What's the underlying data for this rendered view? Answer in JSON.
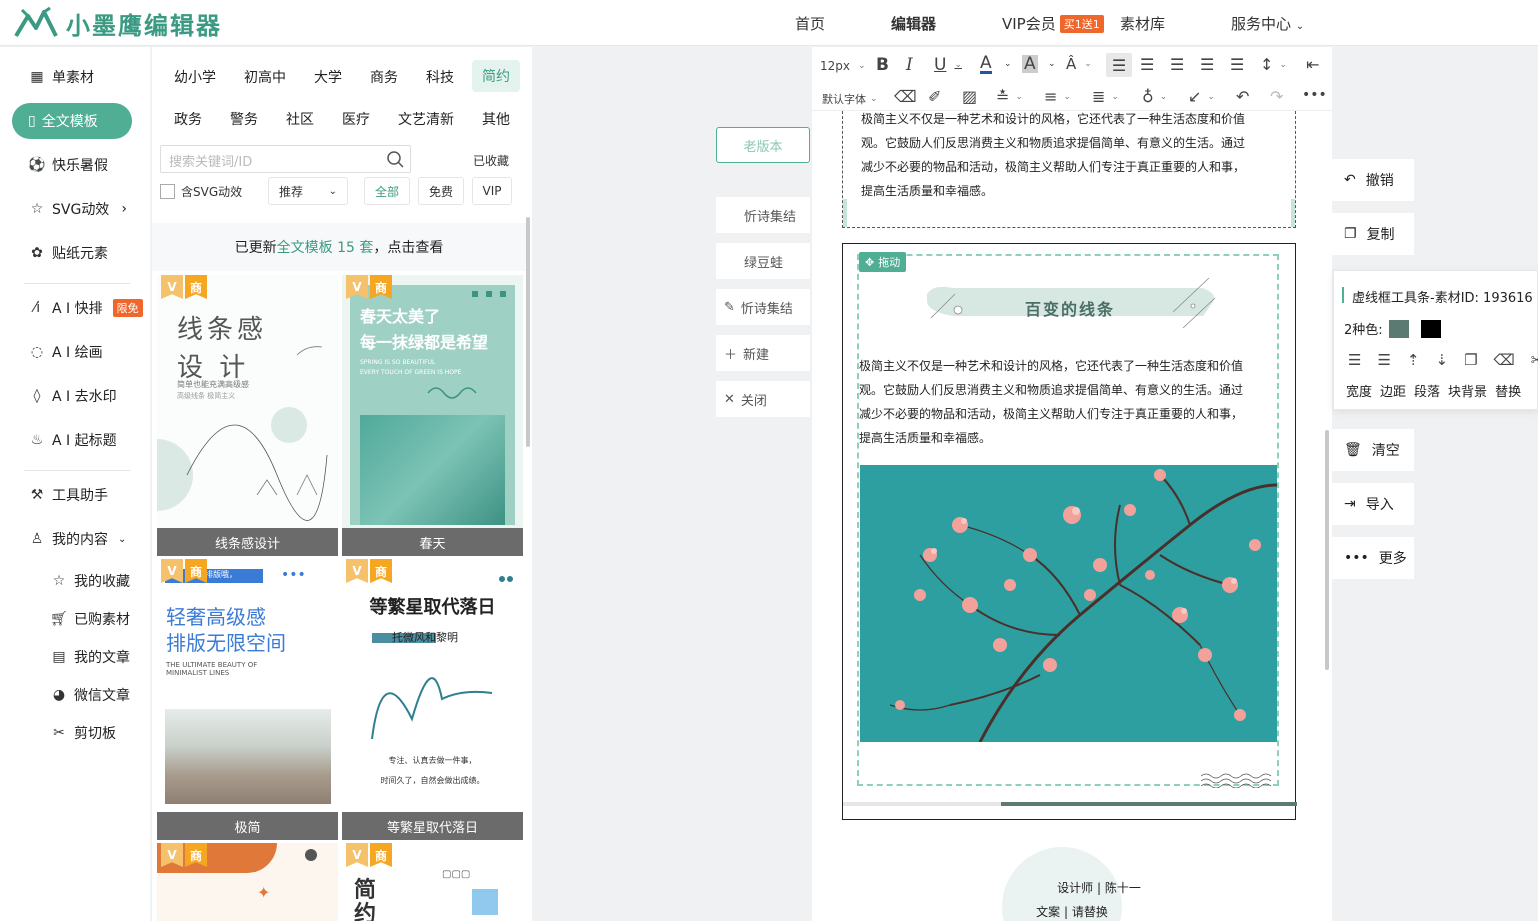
{
  "brand": {
    "name": "小墨鹰编辑器",
    "accent": "#4fae94"
  },
  "nav": {
    "home": "首页",
    "editor": "编辑器",
    "vip": "VIP会员",
    "vip_tag": "买1送1",
    "library": "素材库",
    "service": "服务中心"
  },
  "sidebar": {
    "single": "单素材",
    "full_template": "全文模板",
    "summer": "快乐暑假",
    "svg": "SVG动效",
    "stickers": "贴纸元素",
    "ai_typeset": "A I 快排",
    "ai_typeset_tag": "限免",
    "ai_draw": "A I 绘画",
    "ai_watermark": "A I 去水印",
    "ai_title": "A I 起标题",
    "tools": "工具助手",
    "my_content": "我的内容",
    "favorites": "我的收藏",
    "purchased": "已购素材",
    "articles": "我的文章",
    "wechat": "微信文章",
    "clipboard": "剪切板"
  },
  "templates": {
    "categories_row1": [
      "幼小学",
      "初高中",
      "大学",
      "商务",
      "科技",
      "简约"
    ],
    "categories_row2": [
      "政务",
      "警务",
      "社区",
      "医疗",
      "文艺清新",
      "其他"
    ],
    "search_placeholder": "搜索关键词/ID",
    "collected": "已收藏",
    "svg_check": "含SVG动效",
    "sort": "推荐",
    "filters": [
      "全部",
      "免费",
      "VIP"
    ],
    "banner_pre": "已更新",
    "banner_link": "全文模板 15 套",
    "banner_post": "，点击查看",
    "badge": "商",
    "cards": [
      {
        "label": "线条感设计",
        "title1": "线条感",
        "title2": "设  计",
        "sub1": "简单也能充满高级感",
        "sub2": "高级线条 极简主义"
      },
      {
        "label": "春天",
        "title1": "春天太美了",
        "title2": "每一抹绿都是希望",
        "sub1": "SPRING IS SO BEAUTIFUL",
        "sub2": "EVERY TOUCH OF GREEN IS HOPE"
      },
      {
        "label": "极简",
        "title1": "轻奢高级感",
        "title2": "排版无限空间",
        "sub1": "THE ULTIMATE BEAUTY OF",
        "sub2": "MINIMALIST LINES",
        "tag": "排版哦，"
      },
      {
        "label": "等繁星取代落日",
        "title1": "等繁星取代落日",
        "title2": "托微风和黎明",
        "sub1": "专注、认真去做一件事，",
        "sub2": "时间久了，自然会做出成绩。"
      },
      {
        "label": "",
        "title1": "",
        "title2": "",
        "sub1": "",
        "sub2": ""
      },
      {
        "label": "",
        "title1": "简约",
        "title2": "",
        "sub1": "",
        "sub2": ""
      }
    ]
  },
  "versions": {
    "old": "老版本",
    "items": [
      "忻诗集结",
      "绿豆蛙",
      "忻诗集结"
    ],
    "new": "新建",
    "close": "关闭"
  },
  "toolbar": {
    "font_size": "12px",
    "font_family": "默认字体"
  },
  "article": {
    "para_top_1": "极简主义不仅是一种艺术和设计的风格，它还代表了一种生活态度和价值",
    "para_top_2": "观。它鼓励人们反思消费主义和物质追求提倡简单、有意义的生活。通过",
    "para_top_3": "减少不必要的物品和活动，极简主义帮助人们专注于真正重要的人和事，",
    "para_top_4": "提高生活质量和幸福感。",
    "drag": "拖动",
    "heading": "百变的线条",
    "para_1": "极简主义不仅是一种艺术和设计的风格，它还代表了一种生活态度和价值",
    "para_2": "观。它鼓励人们反思消费主义和物质追求提倡简单、有意义的生活。通过",
    "para_3": "减少不必要的物品和活动，极简主义帮助人们专注于真正重要的人和事，",
    "para_4": "提高生活质量和幸福感。",
    "footer_1": "设计师 | 陈十一",
    "footer_2": "文案 | 请替换"
  },
  "right_tools": {
    "undo": "撤销",
    "copy": "复制",
    "clear": "清空",
    "import": "导入",
    "more": "更多"
  },
  "popup": {
    "title": "虚线框工具条-素材ID: 193616",
    "colors_label": "2种色:",
    "colors": [
      "#5b7b72",
      "#000000"
    ],
    "actions": [
      "宽度",
      "边距",
      "段落",
      "块背景",
      "替换"
    ]
  }
}
